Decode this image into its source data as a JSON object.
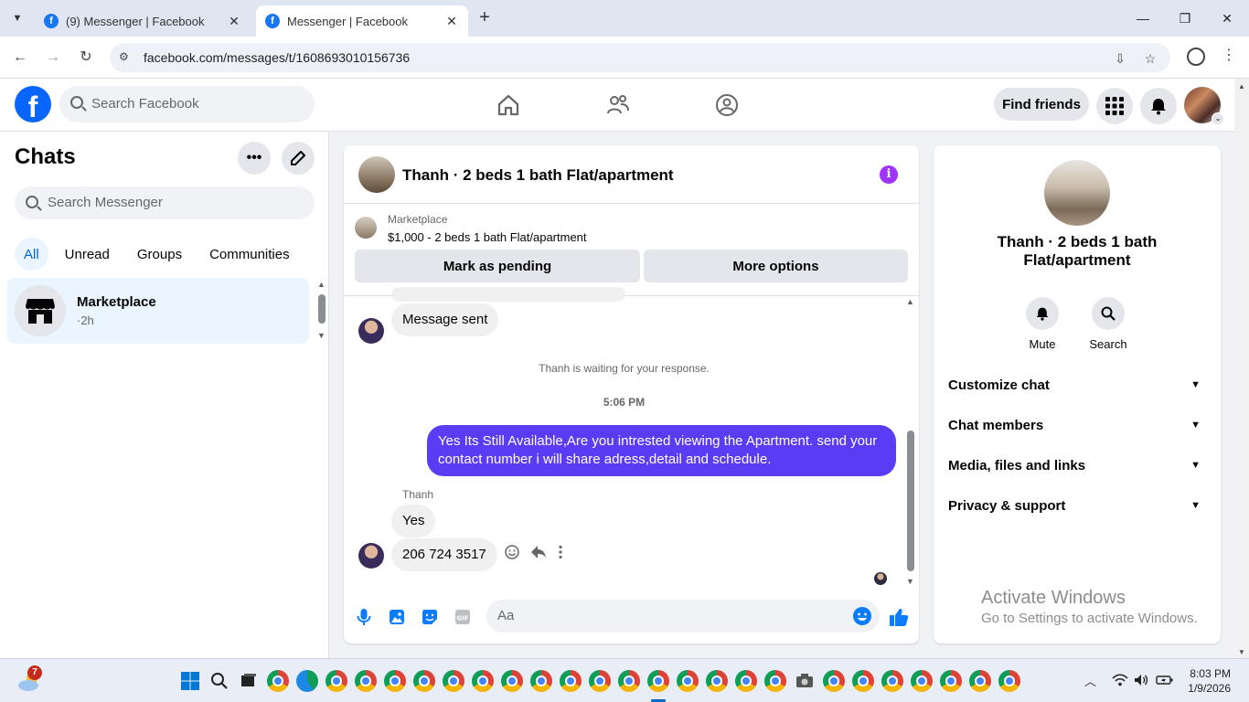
{
  "browser": {
    "tabs": [
      {
        "title": "(9) Messenger | Facebook",
        "active": false
      },
      {
        "title": "Messenger | Facebook",
        "active": true
      }
    ],
    "url": "facebook.com/messages/t/1608693010156736"
  },
  "fb_header": {
    "logo": "f",
    "search_placeholder": "Search Facebook",
    "find_friends": "Find friends"
  },
  "sidebar": {
    "title": "Chats",
    "search_placeholder": "Search Messenger",
    "filters": [
      "All",
      "Unread",
      "Groups",
      "Communities"
    ],
    "active_filter": "All",
    "chats": [
      {
        "name": "Marketplace",
        "time": "·2h"
      }
    ]
  },
  "conversation": {
    "title": "Thanh · 2 beds 1 bath Flat/apartment",
    "marketplace_label": "Marketplace",
    "listing": "$1,000 - 2 beds 1 bath Flat/apartment",
    "mark_pending": "Mark as pending",
    "more_options": "More options",
    "messages": {
      "sent_notice": "Message sent",
      "waiting": "Thanh is waiting for your response.",
      "time": "5:06 PM",
      "outgoing": "Yes Its Still Available,Are you intrested viewing the Apartment. send your contact number i will share adress,detail and schedule.",
      "sender": "Thanh",
      "reply1": "Yes",
      "reply2": "206 724 3517"
    },
    "composer_placeholder": "Aa"
  },
  "info_panel": {
    "name": "Thanh · 2 beds 1 bath Flat/apartment",
    "actions": [
      "Mute",
      "Search"
    ],
    "sections": [
      "Customize chat",
      "Chat members",
      "Media, files and links",
      "Privacy & support"
    ]
  },
  "watermark": {
    "title": "Activate Windows",
    "subtitle": "Go to Settings to activate Windows."
  },
  "taskbar": {
    "weather_badge": "7",
    "time": "8:03 PM",
    "date": "1/9/2026"
  },
  "colors": {
    "fb_blue": "#0866ff",
    "outgoing_bubble": "#5b3cf5",
    "info_purple": "#a033ff",
    "filter_active": "#0064d1"
  }
}
